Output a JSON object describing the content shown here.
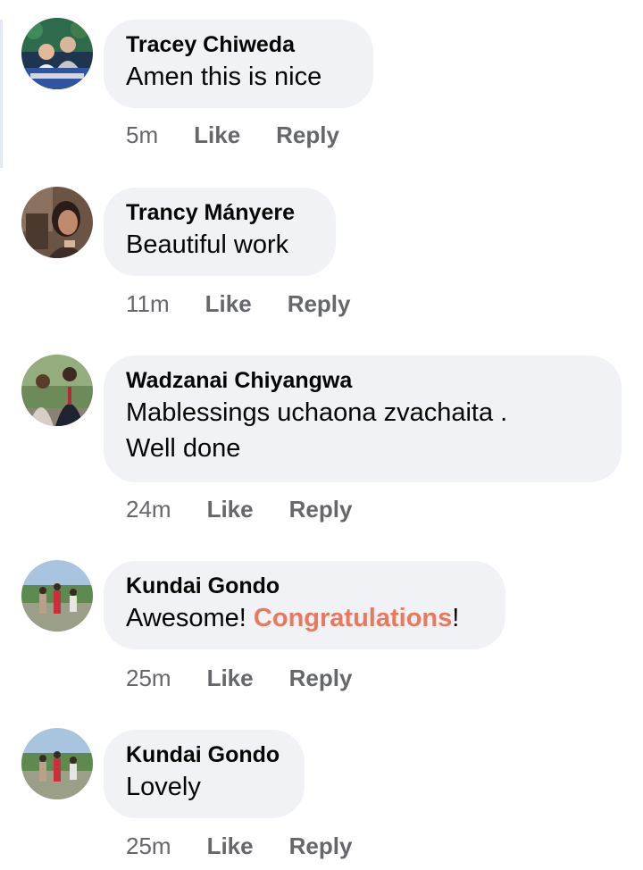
{
  "comments": [
    {
      "author": "Tracey Chiweda",
      "text": "Amen this is nice",
      "time": "5m",
      "like": "Like",
      "reply": "Reply"
    },
    {
      "author": "Trancy Mányere",
      "text": "Beautiful work",
      "time": "11m",
      "like": "Like",
      "reply": "Reply"
    },
    {
      "author": "Wadzanai Chiyangwa",
      "text_line1": "Mablessings uchaona zvachaita .",
      "text_line2": "Well done",
      "time": "24m",
      "like": "Like",
      "reply": "Reply"
    },
    {
      "author": "Kundai Gondo",
      "text_pre": "Awesome! ",
      "text_link": "Congratulations",
      "text_post": "!",
      "time": "25m",
      "like": "Like",
      "reply": "Reply"
    },
    {
      "author": "Kundai Gondo",
      "text": "Lovely",
      "time": "25m",
      "like": "Like",
      "reply": "Reply"
    }
  ],
  "colors": {
    "bubble": "#f0f2f5",
    "meta": "#65676b",
    "highlight": "#e8795f"
  },
  "icons": [
    "avatar-photo"
  ]
}
